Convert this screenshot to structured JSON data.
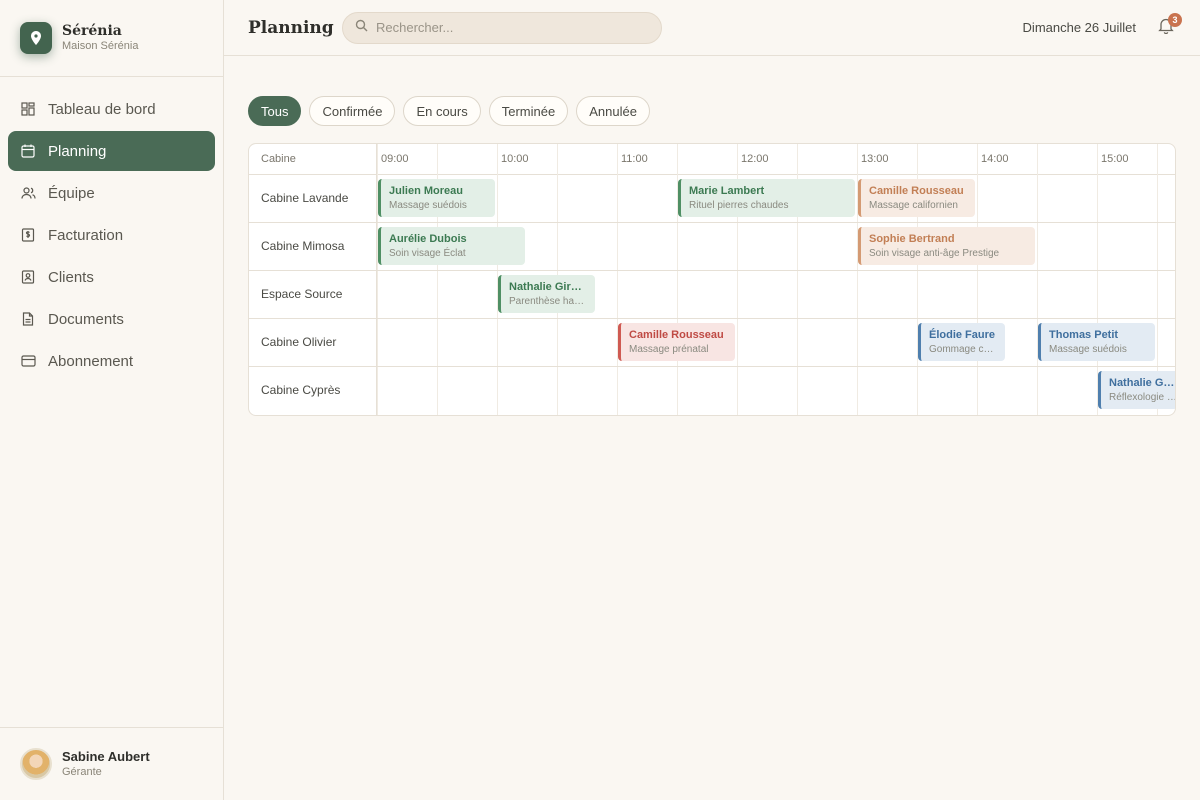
{
  "brand": {
    "name": "Sérénia",
    "subtitle": "Maison Sérénia"
  },
  "nav": [
    {
      "label": "Tableau de bord",
      "icon": "dashboard-icon",
      "active": false
    },
    {
      "label": "Planning",
      "icon": "calendar-icon",
      "active": true
    },
    {
      "label": "Équipe",
      "icon": "users-icon",
      "active": false
    },
    {
      "label": "Facturation",
      "icon": "invoice-icon",
      "active": false
    },
    {
      "label": "Clients",
      "icon": "contact-icon",
      "active": false
    },
    {
      "label": "Documents",
      "icon": "document-icon",
      "active": false
    },
    {
      "label": "Abonnement",
      "icon": "card-icon",
      "active": false
    }
  ],
  "user": {
    "name": "Sabine Aubert",
    "role": "Gérante"
  },
  "header": {
    "title": "Planning",
    "search_placeholder": "Rechercher...",
    "date": "Dimanche 26 Juillet",
    "notifications": "3"
  },
  "filters": [
    "Tous",
    "Confirmée",
    "En cours",
    "Terminée",
    "Annulée"
  ],
  "active_filter": "Tous",
  "schedule": {
    "label_header": "Cabine",
    "times": [
      "09:00",
      "10:00",
      "11:00",
      "12:00",
      "13:00",
      "14:00",
      "15:00"
    ],
    "rows": [
      {
        "cabine": "Cabine Lavande",
        "appointments": [
          {
            "name": "Julien Moreau",
            "service": "Massage suédois",
            "start": "09:00",
            "end": "10:00",
            "status": "green"
          },
          {
            "name": "Marie Lambert",
            "service": "Rituel pierres chaudes",
            "start": "11:30",
            "end": "13:00",
            "status": "green"
          },
          {
            "name": "Camille Rousseau",
            "service": "Massage californien",
            "start": "13:00",
            "end": "14:00",
            "status": "orange"
          }
        ]
      },
      {
        "cabine": "Cabine Mimosa",
        "appointments": [
          {
            "name": "Aurélie Dubois",
            "service": "Soin visage Éclat",
            "start": "09:00",
            "end": "10:15",
            "status": "green"
          },
          {
            "name": "Sophie Bertrand",
            "service": "Soin visage anti-âge Prestige",
            "start": "13:00",
            "end": "14:30",
            "status": "orange"
          }
        ]
      },
      {
        "cabine": "Espace Source",
        "appointments": [
          {
            "name": "Nathalie Girard",
            "service": "Parenthèse ham...",
            "start": "10:00",
            "end": "10:50",
            "status": "green"
          }
        ]
      },
      {
        "cabine": "Cabine Olivier",
        "appointments": [
          {
            "name": "Camille Rousseau",
            "service": "Massage prénatal",
            "start": "11:00",
            "end": "12:00",
            "status": "red"
          },
          {
            "name": "Élodie Faure",
            "service": "Gommage cor...",
            "start": "13:30",
            "end": "14:15",
            "status": "blue"
          },
          {
            "name": "Thomas Petit",
            "service": "Massage suédois",
            "start": "14:30",
            "end": "15:30",
            "status": "blue"
          }
        ]
      },
      {
        "cabine": "Cabine Cyprès",
        "appointments": [
          {
            "name": "Nathalie Girard",
            "service": "Réflexologie pl...",
            "start": "15:00",
            "end": "15:45",
            "status": "blue"
          }
        ]
      }
    ]
  },
  "colors": {
    "primary": "#4a6b56",
    "green": "#4f8f64",
    "orange": "#d49a73",
    "red": "#cf5a52",
    "blue": "#4f7fae",
    "badge": "#c9734f"
  }
}
